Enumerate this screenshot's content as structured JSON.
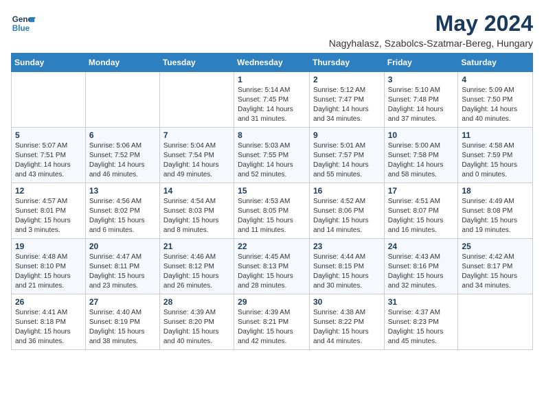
{
  "header": {
    "logo_line1": "General",
    "logo_line2": "Blue",
    "month": "May 2024",
    "location": "Nagyhalasz, Szabolcs-Szatmar-Bereg, Hungary"
  },
  "weekdays": [
    "Sunday",
    "Monday",
    "Tuesday",
    "Wednesday",
    "Thursday",
    "Friday",
    "Saturday"
  ],
  "weeks": [
    [
      {
        "day": "",
        "info": ""
      },
      {
        "day": "",
        "info": ""
      },
      {
        "day": "",
        "info": ""
      },
      {
        "day": "1",
        "info": "Sunrise: 5:14 AM\nSunset: 7:45 PM\nDaylight: 14 hours\nand 31 minutes."
      },
      {
        "day": "2",
        "info": "Sunrise: 5:12 AM\nSunset: 7:47 PM\nDaylight: 14 hours\nand 34 minutes."
      },
      {
        "day": "3",
        "info": "Sunrise: 5:10 AM\nSunset: 7:48 PM\nDaylight: 14 hours\nand 37 minutes."
      },
      {
        "day": "4",
        "info": "Sunrise: 5:09 AM\nSunset: 7:50 PM\nDaylight: 14 hours\nand 40 minutes."
      }
    ],
    [
      {
        "day": "5",
        "info": "Sunrise: 5:07 AM\nSunset: 7:51 PM\nDaylight: 14 hours\nand 43 minutes."
      },
      {
        "day": "6",
        "info": "Sunrise: 5:06 AM\nSunset: 7:52 PM\nDaylight: 14 hours\nand 46 minutes."
      },
      {
        "day": "7",
        "info": "Sunrise: 5:04 AM\nSunset: 7:54 PM\nDaylight: 14 hours\nand 49 minutes."
      },
      {
        "day": "8",
        "info": "Sunrise: 5:03 AM\nSunset: 7:55 PM\nDaylight: 14 hours\nand 52 minutes."
      },
      {
        "day": "9",
        "info": "Sunrise: 5:01 AM\nSunset: 7:57 PM\nDaylight: 14 hours\nand 55 minutes."
      },
      {
        "day": "10",
        "info": "Sunrise: 5:00 AM\nSunset: 7:58 PM\nDaylight: 14 hours\nand 58 minutes."
      },
      {
        "day": "11",
        "info": "Sunrise: 4:58 AM\nSunset: 7:59 PM\nDaylight: 15 hours\nand 0 minutes."
      }
    ],
    [
      {
        "day": "12",
        "info": "Sunrise: 4:57 AM\nSunset: 8:01 PM\nDaylight: 15 hours\nand 3 minutes."
      },
      {
        "day": "13",
        "info": "Sunrise: 4:56 AM\nSunset: 8:02 PM\nDaylight: 15 hours\nand 6 minutes."
      },
      {
        "day": "14",
        "info": "Sunrise: 4:54 AM\nSunset: 8:03 PM\nDaylight: 15 hours\nand 8 minutes."
      },
      {
        "day": "15",
        "info": "Sunrise: 4:53 AM\nSunset: 8:05 PM\nDaylight: 15 hours\nand 11 minutes."
      },
      {
        "day": "16",
        "info": "Sunrise: 4:52 AM\nSunset: 8:06 PM\nDaylight: 15 hours\nand 14 minutes."
      },
      {
        "day": "17",
        "info": "Sunrise: 4:51 AM\nSunset: 8:07 PM\nDaylight: 15 hours\nand 16 minutes."
      },
      {
        "day": "18",
        "info": "Sunrise: 4:49 AM\nSunset: 8:08 PM\nDaylight: 15 hours\nand 19 minutes."
      }
    ],
    [
      {
        "day": "19",
        "info": "Sunrise: 4:48 AM\nSunset: 8:10 PM\nDaylight: 15 hours\nand 21 minutes."
      },
      {
        "day": "20",
        "info": "Sunrise: 4:47 AM\nSunset: 8:11 PM\nDaylight: 15 hours\nand 23 minutes."
      },
      {
        "day": "21",
        "info": "Sunrise: 4:46 AM\nSunset: 8:12 PM\nDaylight: 15 hours\nand 26 minutes."
      },
      {
        "day": "22",
        "info": "Sunrise: 4:45 AM\nSunset: 8:13 PM\nDaylight: 15 hours\nand 28 minutes."
      },
      {
        "day": "23",
        "info": "Sunrise: 4:44 AM\nSunset: 8:15 PM\nDaylight: 15 hours\nand 30 minutes."
      },
      {
        "day": "24",
        "info": "Sunrise: 4:43 AM\nSunset: 8:16 PM\nDaylight: 15 hours\nand 32 minutes."
      },
      {
        "day": "25",
        "info": "Sunrise: 4:42 AM\nSunset: 8:17 PM\nDaylight: 15 hours\nand 34 minutes."
      }
    ],
    [
      {
        "day": "26",
        "info": "Sunrise: 4:41 AM\nSunset: 8:18 PM\nDaylight: 15 hours\nand 36 minutes."
      },
      {
        "day": "27",
        "info": "Sunrise: 4:40 AM\nSunset: 8:19 PM\nDaylight: 15 hours\nand 38 minutes."
      },
      {
        "day": "28",
        "info": "Sunrise: 4:39 AM\nSunset: 8:20 PM\nDaylight: 15 hours\nand 40 minutes."
      },
      {
        "day": "29",
        "info": "Sunrise: 4:39 AM\nSunset: 8:21 PM\nDaylight: 15 hours\nand 42 minutes."
      },
      {
        "day": "30",
        "info": "Sunrise: 4:38 AM\nSunset: 8:22 PM\nDaylight: 15 hours\nand 44 minutes."
      },
      {
        "day": "31",
        "info": "Sunrise: 4:37 AM\nSunset: 8:23 PM\nDaylight: 15 hours\nand 45 minutes."
      },
      {
        "day": "",
        "info": ""
      }
    ]
  ]
}
